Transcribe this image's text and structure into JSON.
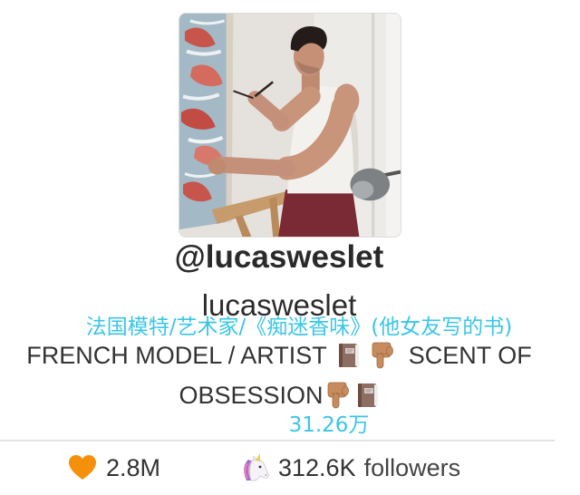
{
  "profile": {
    "handle": "@lucasweslet",
    "display_name": "lucasweslet",
    "bio": {
      "line1": {
        "text_a": "FRENCH MODEL / ARTIST",
        "icons": [
          "notebook-icon",
          "point-down-icon"
        ],
        "text_b": "SCENT OF"
      },
      "line2": {
        "text_a": "OBSESSION",
        "icons": [
          "point-down-icon",
          "notebook-icon"
        ]
      }
    }
  },
  "overlay": {
    "translation": "法国模特/艺术家/《痴迷香味》(他女友写的书)",
    "count": "31.26万"
  },
  "stats": {
    "likes": {
      "icon": "orange-heart-icon",
      "value": "2.8M"
    },
    "followers": {
      "icon": "unicorn-icon",
      "value": "312.6K",
      "label": "followers"
    }
  },
  "colors": {
    "text": "#333333",
    "overlay_text": "#3ac6e6",
    "divider": "#e3e3e3",
    "heart": "#f4900c",
    "pants": "#7a2a34"
  }
}
